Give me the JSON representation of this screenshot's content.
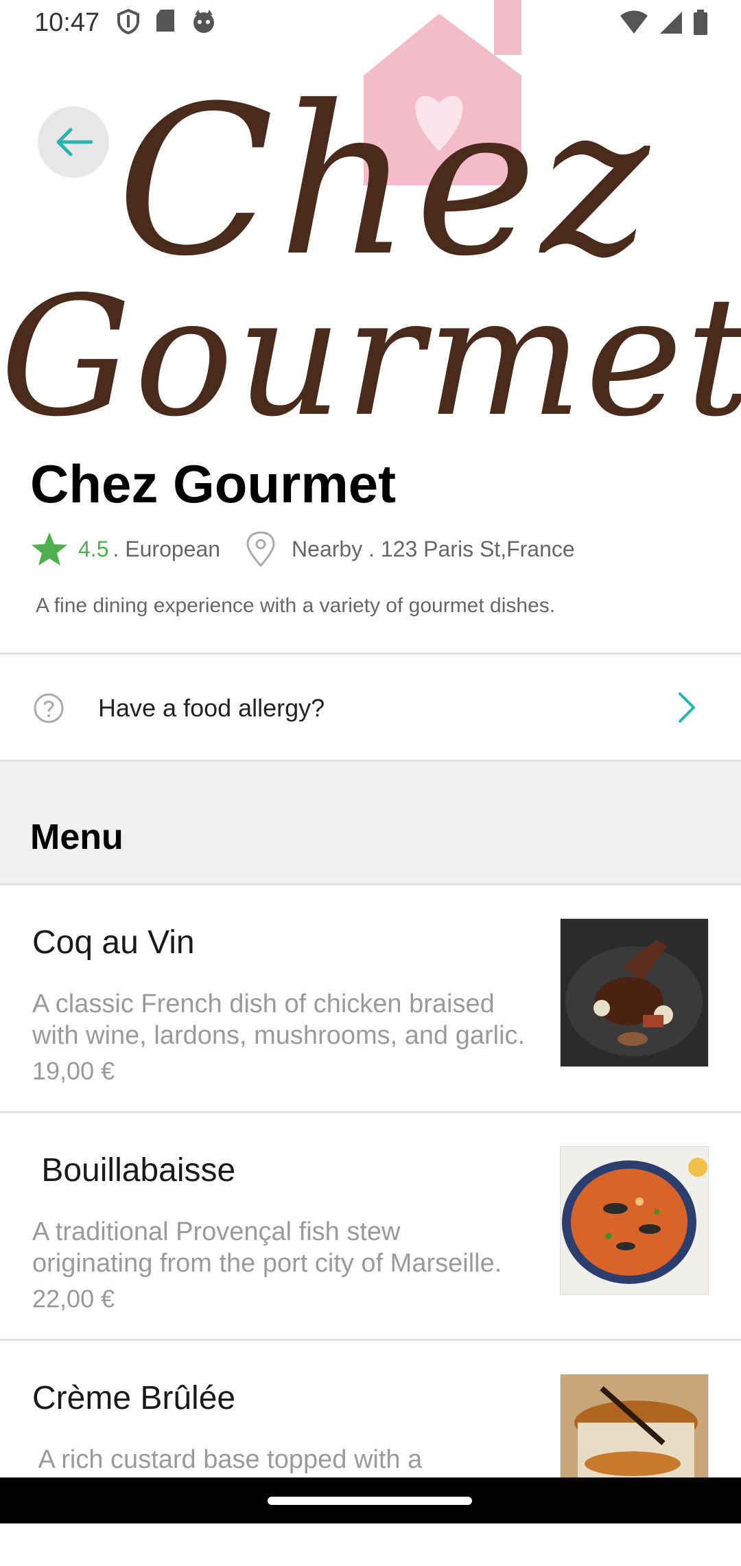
{
  "status_bar": {
    "time": "10:47"
  },
  "hero": {
    "logo_line1": "Chez",
    "logo_line2": "Gourmet"
  },
  "restaurant": {
    "name": "Chez Gourmet",
    "rating": "4.5",
    "cuisine": ". European",
    "location": "Nearby . 123 Paris St,France",
    "description": "A fine dining experience with a variety of gourmet dishes."
  },
  "allergy": {
    "label": "Have a food allergy?"
  },
  "menu": {
    "title": "Menu",
    "items": [
      {
        "name": "Coq au Vin",
        "description": "A classic French dish of chicken braised\nwith wine, lardons, mushrooms, and garlic.",
        "price": "19,00 €"
      },
      {
        "name": " Bouillabaisse",
        "description": "A traditional Provençal fish stew\noriginating from the port city of Marseille.",
        "price": "22,00 €"
      },
      {
        "name": "Crème Brûlée",
        "description": " A rich custard base topped with a",
        "price": ""
      }
    ]
  },
  "colors": {
    "accent": "#26b5b0",
    "rating": "#4caf50",
    "logo_brown": "#4a2a1a",
    "logo_pink": "#f4bccb"
  }
}
